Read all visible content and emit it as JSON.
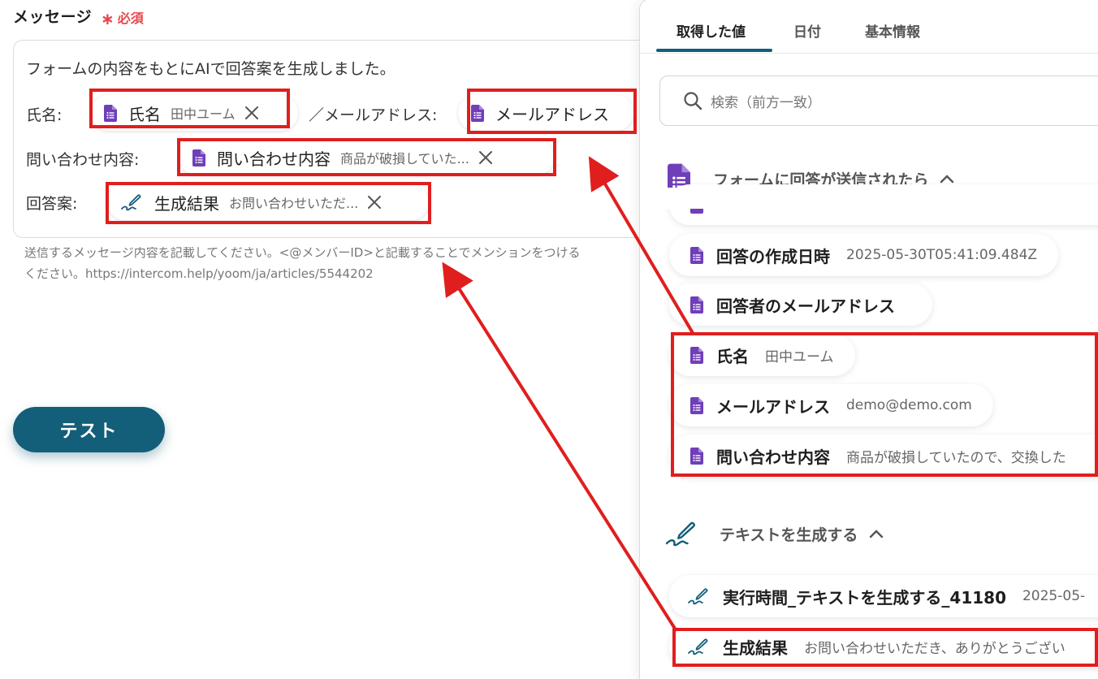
{
  "form": {
    "title": "メッセージ",
    "required": "必須",
    "line1": "フォームの内容をもとにAIで回答案を生成しました。",
    "name_label": "氏名:",
    "sep_email_label": "／メールアドレス:",
    "inquiry_label": "問い合わせ内容:",
    "answer_label": "回答案:",
    "chips": {
      "name": {
        "name": "氏名",
        "value": "田中ユーム"
      },
      "email": {
        "name": "メールアドレス"
      },
      "inquiry": {
        "name": "問い合わせ内容",
        "value": "商品が破損していた..."
      },
      "result": {
        "name": "生成結果",
        "value": "お問い合わせいただ..."
      }
    },
    "hint_line1": "送信するメッセージ内容を記載してください。<@メンバーID>と記載することでメンションをつける",
    "hint_line2": "ください。https://intercom.help/yoom/ja/articles/5544202",
    "test_button": "テスト"
  },
  "panel": {
    "tabs": [
      "取得した値",
      "日付",
      "基本情報"
    ],
    "search_placeholder": "検索（前方一致）",
    "section1_title": "フォームに回答が送信されたら",
    "section1_items": [
      {
        "name": "回答の作成日時",
        "value": "2025-05-30T05:41:09.484Z"
      },
      {
        "name": "回答者のメールアドレス",
        "value": ""
      },
      {
        "name": "氏名",
        "value": "田中ユーム"
      },
      {
        "name": "メールアドレス",
        "value": "demo@demo.com"
      },
      {
        "name": "問い合わせ内容",
        "value": "商品が破損していたので、交換した"
      }
    ],
    "section2_title": "テキストを生成する",
    "section2_items": [
      {
        "name": "実行時間_テキストを生成する_41180",
        "value": "2025-05-"
      },
      {
        "name": "生成結果",
        "value": "お問い合わせいただき、ありがとうござい"
      }
    ]
  },
  "colors": {
    "accent": "#135e79",
    "forms_purple": "#6f3fb8",
    "required_red": "#e5484d",
    "annotation_red": "#e01e1e"
  },
  "icons": {
    "form_item": "google-forms-icon",
    "ai_item": "pen-signature-icon",
    "remove": "close-icon",
    "search": "search-icon",
    "collapse": "chevron-up-icon"
  }
}
